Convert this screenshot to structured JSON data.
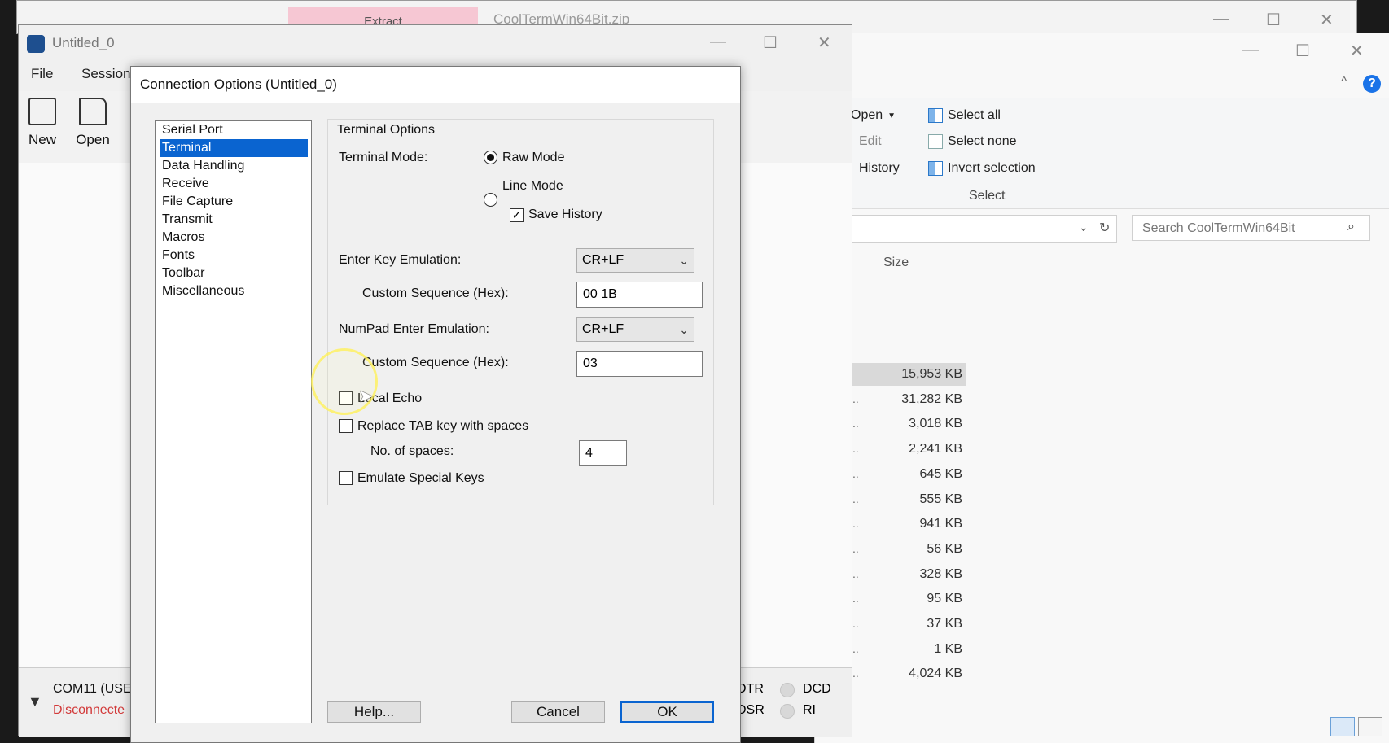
{
  "extract_window": {
    "tab_label": "Extract",
    "title": "CoolTermWin64Bit.zip"
  },
  "explorer": {
    "ribbon": {
      "open_label": "Open",
      "edit_label": "Edit",
      "history_label": "History",
      "select_all": "Select all",
      "select_none": "Select none",
      "invert_selection": "Invert selection",
      "group_label": "Select"
    },
    "search_placeholder": "Search CoolTermWin64Bit",
    "size_header": "Size",
    "file_sizes": [
      "15,953 KB",
      "31,282 KB",
      "3,018 KB",
      "2,241 KB",
      "645 KB",
      "555 KB",
      "941 KB",
      "56 KB",
      "328 KB",
      "95 KB",
      "37 KB",
      "1 KB",
      "4,024 KB"
    ]
  },
  "coolterm": {
    "title": "Untitled_0",
    "menu": {
      "file": "File",
      "session": "Session"
    },
    "toolbar": {
      "new": "New",
      "open": "Open"
    },
    "status": {
      "port": "COM11 (USE",
      "state": "Disconnecte",
      "dtr": "DTR",
      "dsr": "DSR",
      "dcd": "DCD",
      "ri": "RI"
    }
  },
  "dialog": {
    "title": "Connection Options (Untitled_0)",
    "nav": [
      "Serial Port",
      "Terminal",
      "Data Handling",
      "Receive",
      "File Capture",
      "Transmit",
      "Macros",
      "Fonts",
      "Toolbar",
      "Miscellaneous"
    ],
    "selected_nav": "Terminal",
    "section_title": "Terminal Options",
    "terminal_mode_label": "Terminal Mode:",
    "raw_mode": "Raw Mode",
    "line_mode": "Line Mode",
    "save_history": "Save History",
    "enter_key_label": "Enter Key Emulation:",
    "enter_key_value": "CR+LF",
    "custom_seq_label": "Custom Sequence (Hex):",
    "enter_custom_value": "00 1B",
    "numpad_label": "NumPad Enter Emulation:",
    "numpad_value": "CR+LF",
    "numpad_custom_value": "03",
    "local_echo": "Local Echo",
    "replace_tab": "Replace TAB key with spaces",
    "num_spaces_label": "No. of spaces:",
    "num_spaces_value": "4",
    "emulate_special": "Emulate Special Keys",
    "help_btn": "Help...",
    "cancel_btn": "Cancel",
    "ok_btn": "OK"
  }
}
